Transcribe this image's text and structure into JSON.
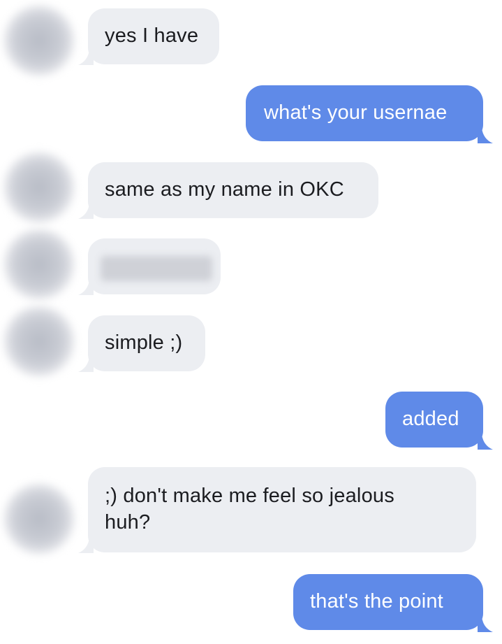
{
  "colors": {
    "incoming_bubble": "#eceef2",
    "outgoing_bubble": "#5f8ae8",
    "incoming_text": "#1b1c20",
    "outgoing_text": "#ffffff"
  },
  "messages": [
    {
      "direction": "incoming",
      "text": "yes I have"
    },
    {
      "direction": "outgoing",
      "text": "what's your usernae"
    },
    {
      "direction": "incoming",
      "text": "same as my name in OKC"
    },
    {
      "direction": "incoming",
      "text": "",
      "redacted": true
    },
    {
      "direction": "incoming",
      "text": "simple ;)"
    },
    {
      "direction": "outgoing",
      "text": "added"
    },
    {
      "direction": "incoming",
      "text_line1": ";) don't make me feel so jealous",
      "text_line2": "huh?"
    },
    {
      "direction": "outgoing",
      "text": "that's the point"
    }
  ]
}
